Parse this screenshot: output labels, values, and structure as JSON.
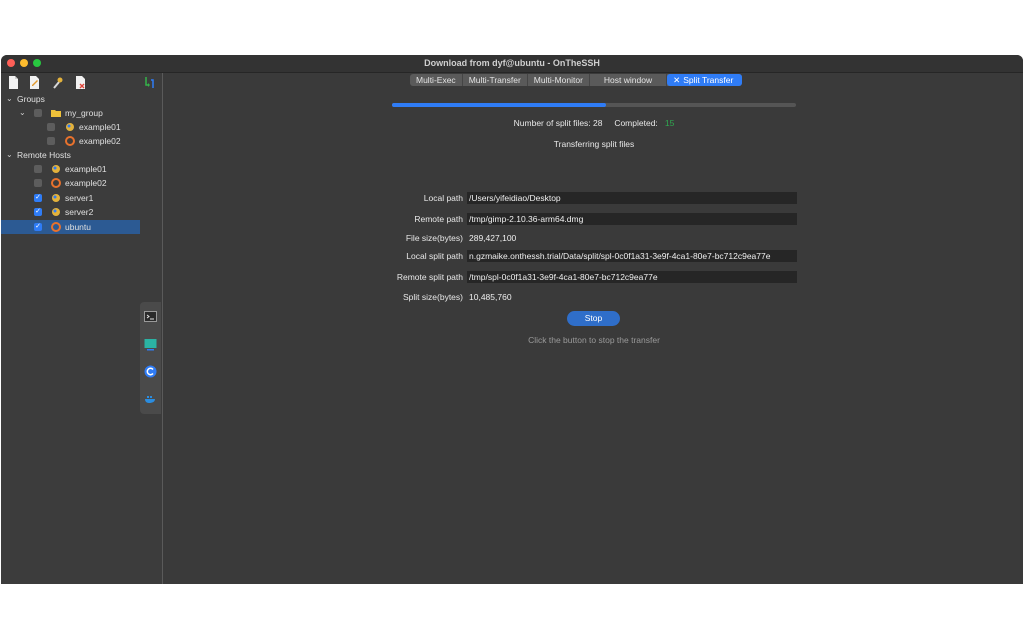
{
  "window": {
    "title": "Download from dyf@ubuntu - OnTheSSH"
  },
  "sidebar": {
    "groups_label": "Groups",
    "my_group_label": "my_group",
    "group_items": [
      "example01",
      "example02"
    ],
    "remote_hosts_label": "Remote Hosts",
    "host_items": [
      {
        "label": "example01",
        "checked": false
      },
      {
        "label": "example02",
        "checked": false
      },
      {
        "label": "server1",
        "checked": true
      },
      {
        "label": "server2",
        "checked": true
      },
      {
        "label": "ubuntu",
        "checked": true,
        "selected": true
      }
    ]
  },
  "tabs": {
    "multi_exec": "Multi-Exec",
    "multi_transfer": "Multi-Transfer",
    "multi_monitor": "Multi-Monitor",
    "host_window": "Host window",
    "split_transfer": "Split Transfer"
  },
  "progress": {
    "fraction": 0.53
  },
  "stats": {
    "split_files_label": "Number of split files:",
    "split_files_value": "28",
    "completed_label": "Completed:",
    "completed_value": "15"
  },
  "status": "Transferring split files",
  "fields": {
    "local_path_label": "Local path",
    "local_path": "/Users/yifeidiao/Desktop",
    "remote_path_label": "Remote path",
    "remote_path": "/tmp/gimp-2.10.36-arm64.dmg",
    "file_size_label": "File size(bytes)",
    "file_size": "289,427,100",
    "local_split_path_label": "Local split path",
    "local_split_path": "n.gzmaike.onthessh.trial/Data/split/spl-0c0f1a31-3e9f-4ca1-80e7-bc712c9ea77e",
    "remote_split_path_label": "Remote split path",
    "remote_split_path": "/tmp/spl-0c0f1a31-3e9f-4ca1-80e7-bc712c9ea77e",
    "split_size_label": "Split size(bytes)",
    "split_size": "10,485,760"
  },
  "actions": {
    "stop_label": "Stop",
    "hint": "Click the button to stop the transfer"
  },
  "colors": {
    "accent": "#2f7cf6",
    "completed": "#2fa84f",
    "selected_row": "#2c5a93"
  }
}
